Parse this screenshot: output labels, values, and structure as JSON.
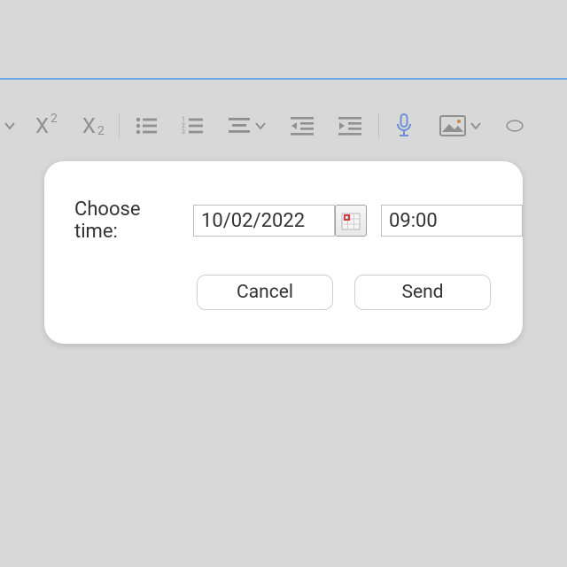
{
  "dialog": {
    "label": "Choose time:",
    "date_value": "10/02/2022",
    "time_value": "09:00",
    "cancel_label": "Cancel",
    "send_label": "Send"
  },
  "toolbar": {
    "superscript_base": "X",
    "superscript_exp": "2",
    "subscript_base": "X",
    "subscript_exp": "2"
  }
}
